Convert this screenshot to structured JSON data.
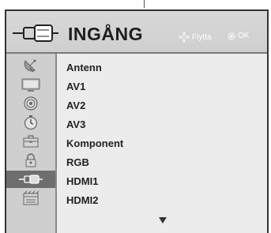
{
  "header": {
    "title": "INGÅNG",
    "hint_move_label": "Flytta",
    "hint_ok_label": "OK"
  },
  "sidebar": {
    "items": [
      {
        "icon": "satellite-dish-icon"
      },
      {
        "icon": "tv-screen-icon"
      },
      {
        "icon": "speaker-icon"
      },
      {
        "icon": "clock-icon"
      },
      {
        "icon": "toolbox-icon"
      },
      {
        "icon": "lock-icon"
      },
      {
        "icon": "input-connector-icon",
        "active": true
      },
      {
        "icon": "usb-film-icon"
      }
    ]
  },
  "input_list": {
    "items": [
      {
        "label": "Antenn"
      },
      {
        "label": "AV1"
      },
      {
        "label": "AV2"
      },
      {
        "label": "AV3"
      },
      {
        "label": "Komponent"
      },
      {
        "label": "RGB"
      },
      {
        "label": "HDMI1"
      },
      {
        "label": "HDMI2"
      }
    ]
  }
}
